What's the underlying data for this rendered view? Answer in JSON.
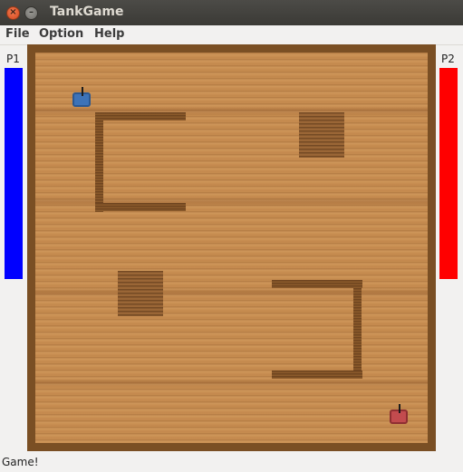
{
  "window": {
    "title": "TankGame",
    "close_glyph": "×",
    "min_glyph": "–"
  },
  "menu": {
    "items": [
      "File",
      "Option",
      "Help"
    ]
  },
  "players": [
    {
      "label": "P1",
      "color": "#0000ff",
      "health": 1.0
    },
    {
      "label": "P2",
      "color": "#ff0000",
      "health": 1.0
    }
  ],
  "status": {
    "text": "Game!"
  }
}
